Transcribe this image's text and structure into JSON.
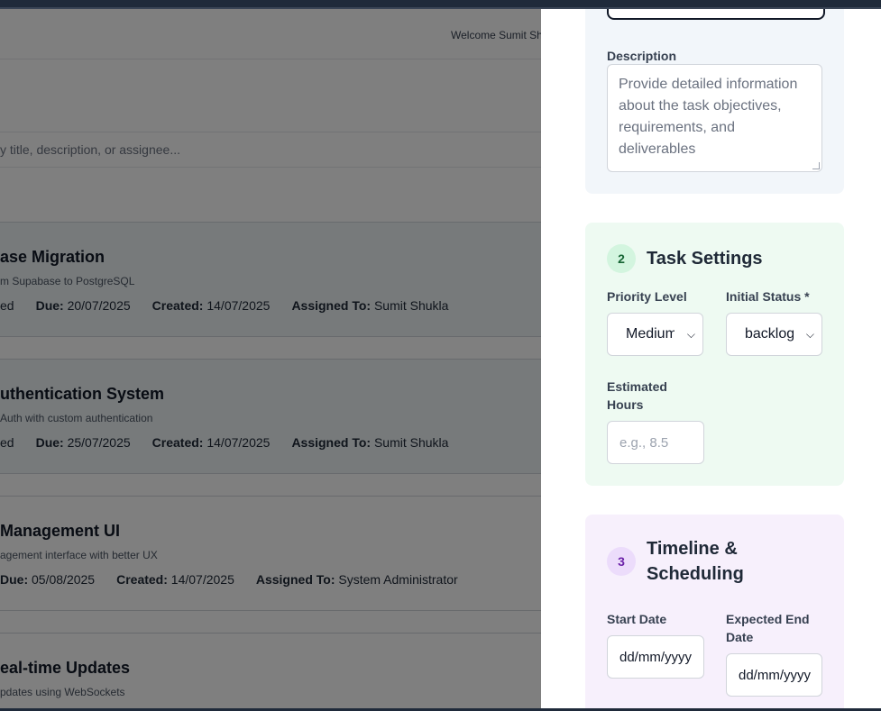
{
  "header": {
    "welcome": "Welcome Sumit Sh"
  },
  "search": {
    "placeholder": "y title, description, or assignee..."
  },
  "tasks": [
    {
      "title": "ase Migration",
      "description": "m Supabase to PostgreSQL",
      "status_fragment": "ed",
      "due_label": "Due:",
      "due": "20/07/2025",
      "created_label": "Created:",
      "created": "14/07/2025",
      "assigned_label": "Assigned To:",
      "assigned": "Sumit Shukla"
    },
    {
      "title": "uthentication System",
      "description": "Auth with custom authentication",
      "status_fragment": "ed",
      "due_label": "Due:",
      "due": "25/07/2025",
      "created_label": "Created:",
      "created": "14/07/2025",
      "assigned_label": "Assigned To:",
      "assigned": "Sumit Shukla"
    },
    {
      "title": "Management UI",
      "description": "agement interface with better UX",
      "status_fragment": "",
      "due_label": "Due:",
      "due": "05/08/2025",
      "created_label": "Created:",
      "created": "14/07/2025",
      "assigned_label": "Assigned To:",
      "assigned": "System Administrator"
    },
    {
      "title": "eal-time Updates",
      "description": "pdates using WebSockets"
    }
  ],
  "panel": {
    "basic": {
      "description_label": "Description",
      "description_placeholder": "Provide detailed information about the task objectives, requirements, and deliverables"
    },
    "settings": {
      "number": "2",
      "title": "Task Settings",
      "priority_label": "Priority Level",
      "priority_value": "Medium",
      "status_label": "Initial Status *",
      "status_value": "backlog",
      "hours_label": "Estimated Hours",
      "hours_placeholder": "e.g., 8.5"
    },
    "timeline": {
      "number": "3",
      "title": "Timeline & Scheduling",
      "start_label": "Start Date",
      "start_value": "dd/mm/yyyy",
      "end_label": "Expected End Date",
      "end_value": "dd/mm/yyyy"
    }
  },
  "colors": {
    "settings_bg": "#eefaf2",
    "timeline_bg": "#f7f0fc",
    "basic_bg": "#f2f6fa",
    "overlay": "rgba(0,0,0,0.5)"
  },
  "icons": {
    "select_chevron": "chevron-down-icon",
    "textarea_grip": "resize-grip-icon"
  }
}
